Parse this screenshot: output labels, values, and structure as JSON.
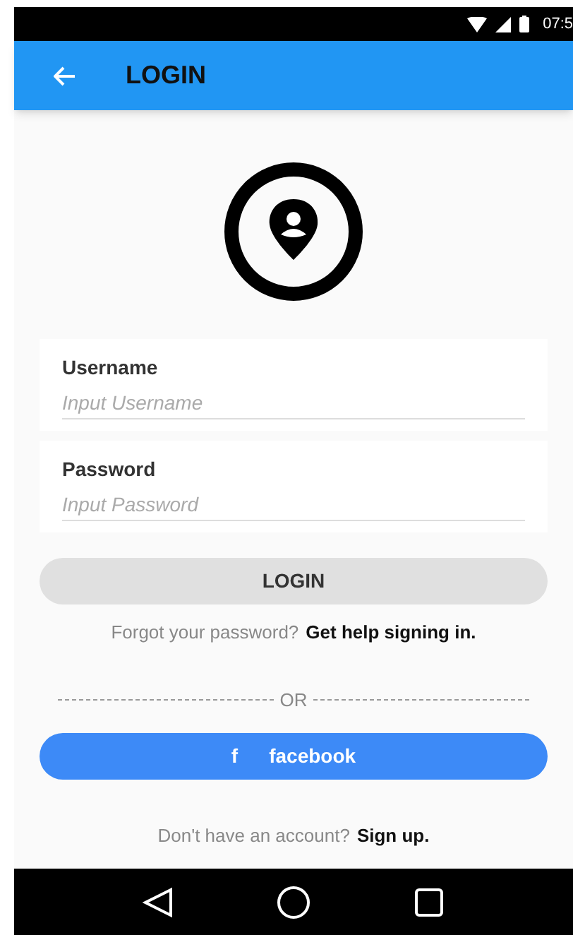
{
  "status_bar": {
    "time": "07:5"
  },
  "app_bar": {
    "title": "LOGIN"
  },
  "fields": [
    {
      "label": "Username",
      "placeholder": "Input Username"
    },
    {
      "label": "Password",
      "placeholder": "Input Password"
    }
  ],
  "login_button": "LOGIN",
  "forgot": {
    "text": "Forgot your password?",
    "link": "Get help signing in."
  },
  "divider": "OR",
  "facebook_button": {
    "icon": "f",
    "label": "facebook"
  },
  "signup": {
    "text": "Don't have an account?",
    "link": "Sign up."
  }
}
